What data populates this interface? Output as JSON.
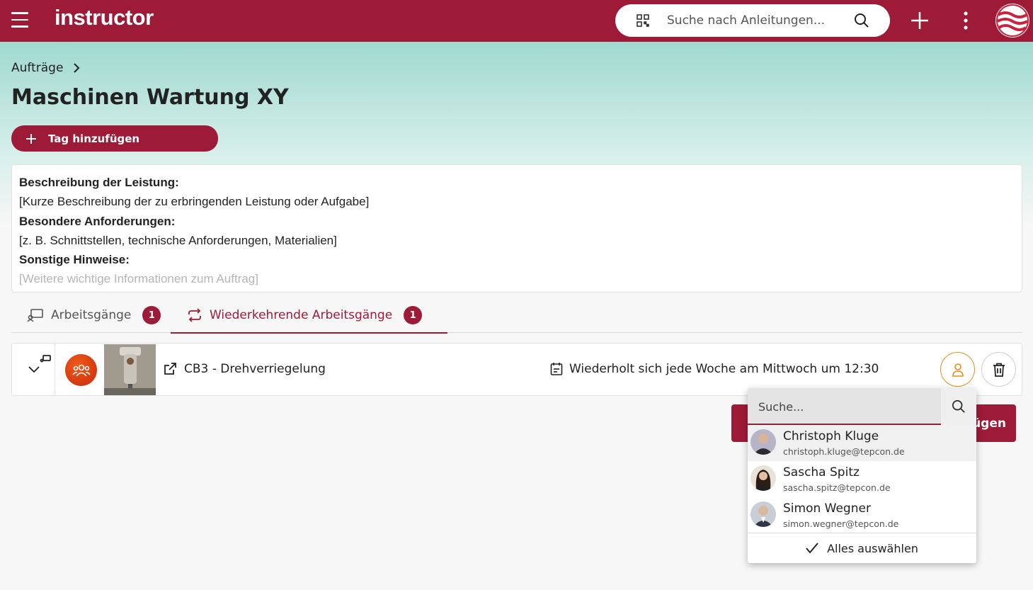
{
  "header": {
    "logo": "instructor",
    "search_placeholder": "Suche nach Anleitungen...",
    "icons": [
      "menu-icon",
      "qr-code-icon",
      "search-icon",
      "plus-icon",
      "more-vert-icon",
      "user-avatar"
    ]
  },
  "breadcrumb": {
    "parent": "Aufträge"
  },
  "page": {
    "title": "Maschinen Wartung XY",
    "add_tag_label": "Tag hinzufügen"
  },
  "description": {
    "lines": [
      {
        "text": "Beschreibung der Leistung:",
        "bold": true
      },
      {
        "text": "[Kurze Beschreibung der zu erbringenden Leistung oder Aufgabe]",
        "bold": false
      },
      {
        "text": "Besondere Anforderungen:",
        "bold": true
      },
      {
        "text": "[z. B. Schnittstellen, technische Anforderungen, Materialien]",
        "bold": false
      },
      {
        "text": "Sonstige Hinweise:",
        "bold": true
      },
      {
        "text": "[Weitere wichtige Informationen zum Auftrag]",
        "bold": false
      }
    ]
  },
  "tabs": [
    {
      "label": "Arbeitsgänge",
      "count": "1",
      "active": false
    },
    {
      "label": "Wiederkehrende Arbeitsgänge",
      "count": "1",
      "active": true
    }
  ],
  "task": {
    "name": "CB3 - Drehverriegelung",
    "schedule": "Wiederholt sich jede Woche am Mittwoch um 12:30"
  },
  "add_button_label": "fügen",
  "dropdown": {
    "search_placeholder": "Suche...",
    "users": [
      {
        "name": "Christoph Kluge",
        "email": "christoph.kluge@tepcon.de"
      },
      {
        "name": "Sascha Spitz",
        "email": "sascha.spitz@tepcon.de"
      },
      {
        "name": "Simon Wegner",
        "email": "simon.wegner@tepcon.de"
      }
    ],
    "select_all_label": "Alles auswählen"
  },
  "colors": {
    "brand": "#9e1b37",
    "accent_orange": "#e0901a",
    "teal_bg": "#9fd9d0"
  }
}
